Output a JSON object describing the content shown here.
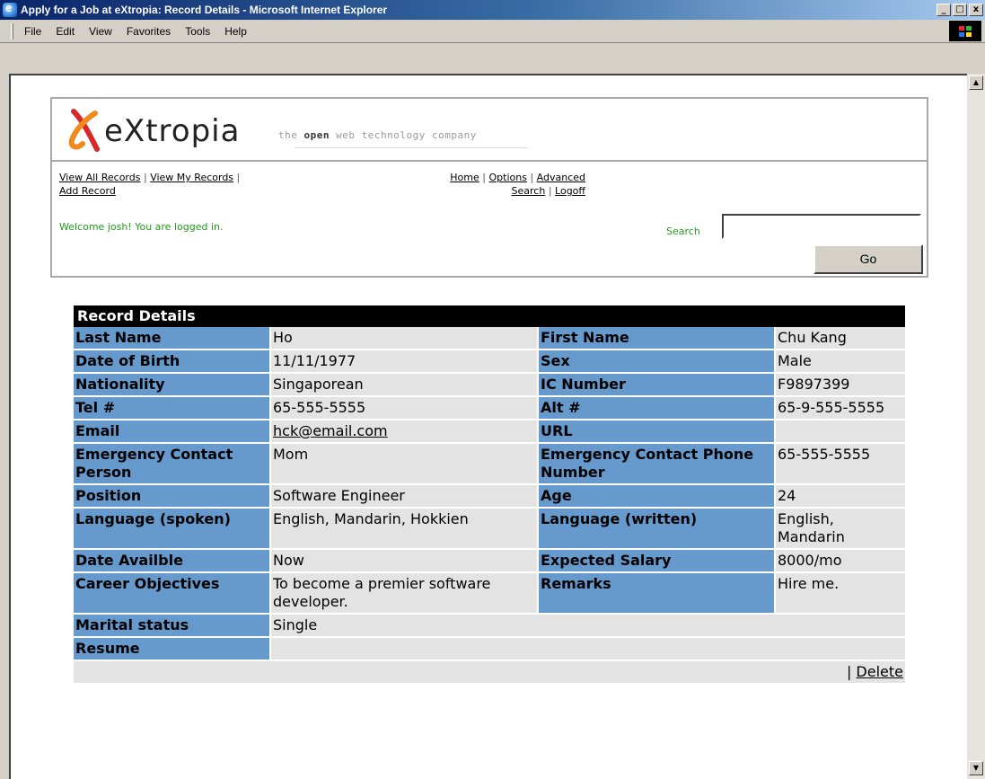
{
  "window": {
    "title": "Apply for a Job at eXtropia: Record Details - Microsoft Internet Explorer",
    "controls": {
      "minimize": "_",
      "maximize": "□",
      "close": "x"
    }
  },
  "menu": {
    "items": [
      "File",
      "Edit",
      "View",
      "Favorites",
      "Tools",
      "Help"
    ]
  },
  "header": {
    "logo_text": "eXtropia",
    "tagline_pre": "the ",
    "tagline_bold": "open",
    "tagline_post": " web technology company"
  },
  "nav": {
    "view_all": "View All Records",
    "view_my": "View My Records",
    "add_record": "Add Record",
    "home": "Home",
    "options": "Options",
    "advanced": "Advanced",
    "search": "Search",
    "logoff": "Logoff",
    "sep": "|"
  },
  "welcome": "Welcome josh! You are logged in.",
  "search": {
    "label": "Search",
    "value": "",
    "go_label": "Go"
  },
  "record": {
    "title": "Record Details",
    "rows": [
      [
        {
          "l": "Last Name",
          "v": "Ho"
        },
        {
          "l": "First Name",
          "v": "Chu Kang"
        }
      ],
      [
        {
          "l": "Date of Birth",
          "v": "11/11/1977"
        },
        {
          "l": "Sex",
          "v": "Male"
        }
      ],
      [
        {
          "l": "Nationality",
          "v": "Singaporean"
        },
        {
          "l": "IC Number",
          "v": "F9897399"
        }
      ],
      [
        {
          "l": "Tel #",
          "v": "65-555-5555"
        },
        {
          "l": "Alt #",
          "v": "65-9-555-5555"
        }
      ],
      [
        {
          "l": "Email",
          "v": "hck@email.com"
        },
        {
          "l": "URL",
          "v": ""
        }
      ],
      [
        {
          "l": "Emergency Contact Person",
          "v": "Mom"
        },
        {
          "l": "Emergency Contact Phone Number",
          "v": "65-555-5555"
        }
      ],
      [
        {
          "l": "Position",
          "v": "Software Engineer"
        },
        {
          "l": "Age",
          "v": "24"
        }
      ],
      [
        {
          "l": "Language (spoken)",
          "v": "English, Mandarin, Hokkien"
        },
        {
          "l": "Language (written)",
          "v": "English, Mandarin"
        }
      ],
      [
        {
          "l": "Date Availble",
          "v": "Now"
        },
        {
          "l": "Expected Salary",
          "v": "8000/mo"
        }
      ],
      [
        {
          "l": "Career Objectives",
          "v": "To become a premier software developer."
        },
        {
          "l": "Remarks",
          "v": "Hire me."
        }
      ]
    ],
    "marital_label": "Marital status",
    "marital_value": "Single",
    "resume_label": "Resume",
    "resume_value": "",
    "footer_sep": "|",
    "delete_label": "Delete"
  },
  "colors": {
    "label_bg": "#6699cc",
    "value_bg": "#e3e3e3",
    "title_bg": "#000000",
    "welcome_green": "#239b1e",
    "logo_orange": "#f08a1c",
    "logo_red": "#d8282a"
  }
}
